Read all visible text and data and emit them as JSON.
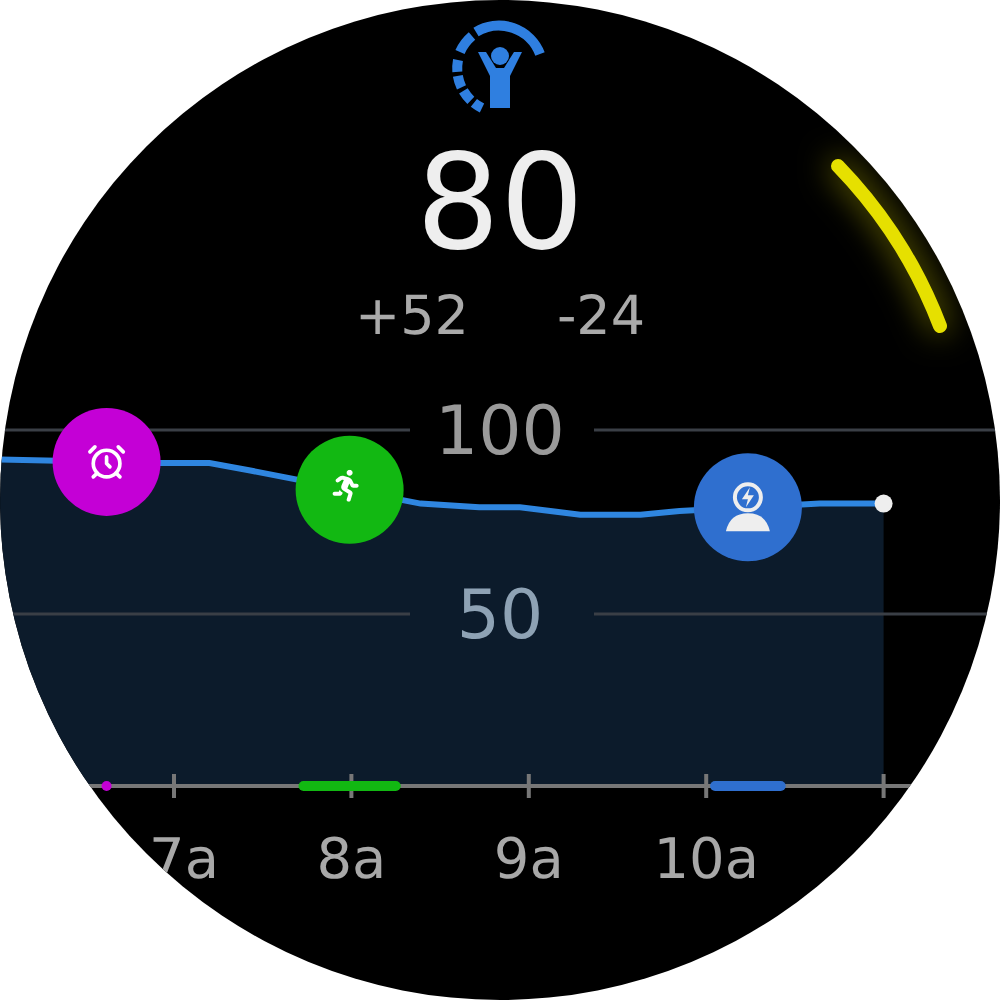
{
  "header": {
    "score": "80",
    "changes": [
      "+52",
      "-24"
    ]
  },
  "chart": {
    "chart_data": {
      "type": "area",
      "x": [
        6.02,
        6.58,
        6.92,
        7.2,
        7.43,
        7.71,
        7.99,
        8.39,
        8.72,
        8.95,
        9.29,
        9.63,
        9.85,
        10.22,
        10.64,
        11.0
      ],
      "series": [
        {
          "color": "#2f86e0",
          "values": [
            92,
            null,
            91,
            91,
            89,
            null,
            null,
            80,
            79,
            79,
            77,
            77,
            78,
            null,
            80,
            80
          ]
        }
      ],
      "xlim": [
        6.02,
        11
      ],
      "ylim": [
        0,
        100
      ],
      "grid": true,
      "xticks": [
        {
          "value": 7,
          "label": "7a"
        },
        {
          "value": 8,
          "label": "8a"
        },
        {
          "value": 9,
          "label": "9a"
        },
        {
          "value": 10,
          "label": "10a"
        }
      ],
      "yticks": [
        {
          "value": 50,
          "label": "50"
        },
        {
          "value": 100,
          "label": "100"
        }
      ]
    },
    "events": [
      {
        "kind": "alarm",
        "color": "#c400d6"
      },
      {
        "kind": "activity",
        "color": "#12b812"
      },
      {
        "kind": "recharge",
        "color": "#2f6fcf"
      }
    ]
  }
}
